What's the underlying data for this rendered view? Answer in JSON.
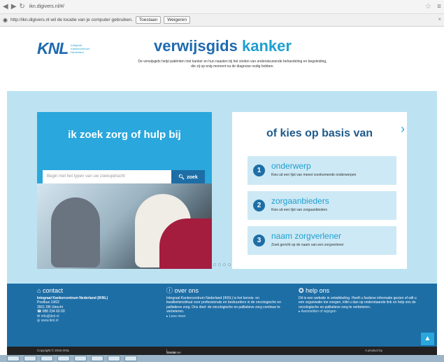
{
  "browser": {
    "url": "ikn.digivers.nl/#/",
    "geo_prompt": "http://ikn.digivers.nl wil de locatie van je computer gebruiken.",
    "allow": "Toestaan",
    "deny": "Weigeren"
  },
  "header": {
    "logo": "KNL",
    "logo_sub": "Integraal Kankercentrum Nederland",
    "title_part1": "verwijsgids",
    "title_part2": "kanker",
    "intro": "De verwijsgids helpt patiënten met kanker en hun naasten bij het vinden van ondersteunende behandeling en begeleiding, die zij op enig moment na de diagnose nodig hebben."
  },
  "search": {
    "title": "ik zoek zorg of hulp bij",
    "placeholder": "Begin met het typen van uw zoekopdracht",
    "button": "zoek"
  },
  "options": {
    "title": "of kies op basis van",
    "items": [
      {
        "num": "1",
        "label": "onderwerp",
        "desc": "Kies uit een lijst van meest voorkomende onderwerpen"
      },
      {
        "num": "2",
        "label": "zorgaanbieders",
        "desc": "Kies uit een lijst van zorgaanbieders"
      },
      {
        "num": "3",
        "label": "naam zorgverlener",
        "desc": "Zoek gericht op de naam van een zorgverlener"
      }
    ]
  },
  "footer": {
    "contact": {
      "heading": "contact",
      "org": "Integraal Kankercentrum Nederland (IKNL)",
      "lines": [
        "Postbus 19/02",
        "3501 DB Utrecht",
        "088 234 60 00",
        "info@iknl.nl",
        "www.iknl.nl"
      ]
    },
    "about": {
      "heading": "over ons",
      "text": "Integraal Kankercentrum Nederland (IKNL) is het kennis- en kwaliteitsinstituut voor professionals en bestuurders in de oncologische en palliatieve zorg. Ons doel: de oncologische en palliatieve zorg continue te verbeteren.",
      "link": "Lees meer"
    },
    "help": {
      "heading": "help ons",
      "text": "Dit is een website in ontwikkeling. Heeft u foutieve informatie gezien of wilt u een organisatie toe voegen, klikt u dan op onderstaande link en help ons de oncologische en palliatieve zorg te verbeteren.",
      "link": "Aanmelden of wijzigen"
    },
    "copyright": "Copyright © 2015 IKNL",
    "disclaimer": "Disclaimer",
    "version": "versie 1.2",
    "product_by": "A product by"
  }
}
